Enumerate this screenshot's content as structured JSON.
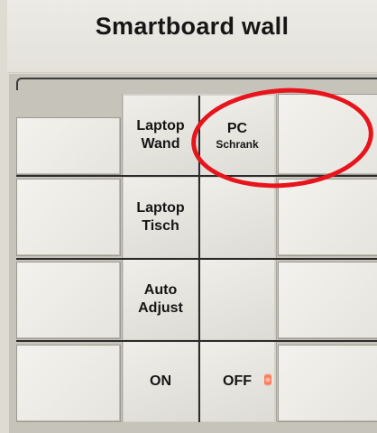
{
  "label_strip": {
    "text": "Smartboard wall"
  },
  "keys": [
    {
      "line1": "Laptop",
      "line2": "Wand"
    },
    {
      "line1": "PC",
      "line2": "Schrank"
    },
    {
      "line1": "Laptop",
      "line2": "Tisch"
    },
    {
      "line1": "",
      "line2": ""
    },
    {
      "line1": "Auto",
      "line2": "Adjust"
    },
    {
      "line1": "",
      "line2": ""
    },
    {
      "line1": "ON",
      "line2": ""
    },
    {
      "line1": "OFF",
      "line2": ""
    }
  ],
  "annotation": {
    "color": "#e8141c",
    "shape": "ellipse"
  },
  "led": {
    "color": "#ff6a4a",
    "state": "on"
  }
}
